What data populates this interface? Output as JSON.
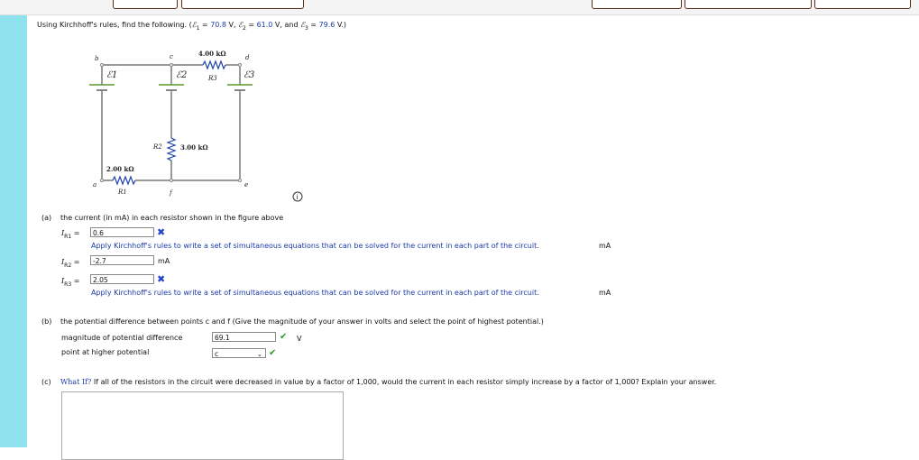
{
  "intro": {
    "text": "Using Kirchhoff's rules, find the following. (",
    "e1": "ℰ",
    "e1_sub": "1",
    "eq": " = ",
    "v1": "70.8",
    "u1": " V, ",
    "e2": "ℰ",
    "e2_sub": "2",
    "v2": "61.0",
    "u2": " V, and ",
    "e3": "ℰ",
    "e3_sub": "3",
    "v3": "79.6",
    "u3": " V.)"
  },
  "circuit": {
    "node_b": "b",
    "node_c": "c",
    "node_d": "d",
    "node_a": "a",
    "node_f": "f",
    "node_e": "e",
    "r3_value": "4.00 kΩ",
    "r3_label": "R3",
    "r2_value": "3.00 kΩ",
    "r2_label": "R2",
    "r1_value": "2.00 kΩ",
    "r1_label": "R1",
    "emf1": "ℰ1",
    "emf2": "ℰ2",
    "emf3": "ℰ3"
  },
  "part_a": {
    "label": "(a)",
    "question": "the current (in mA) in each resistor shown in the figure above",
    "rows": [
      {
        "sym": "I",
        "sub": "R1",
        "value": "0.6",
        "feedback": "Apply Kirchhoff's rules to write a set of simultaneous equations that can be solved for the current in each part of the circuit.",
        "unit": "mA"
      },
      {
        "sym": "I",
        "sub": "R2",
        "value": "-2.7",
        "unit": "mA"
      },
      {
        "sym": "I",
        "sub": "R3",
        "value": "2.05",
        "feedback": "Apply Kirchhoff's rules to write a set of simultaneous equations that can be solved for the current in each part of the circuit.",
        "unit": "mA"
      }
    ]
  },
  "part_b": {
    "label": "(b)",
    "question": "the potential difference between points c and f (Give the magnitude of your answer in volts and select the point of highest potential.)",
    "mag_label": "magnitude of potential difference",
    "mag_value": "69.1",
    "mag_unit": "V",
    "point_label": "point at higher potential",
    "point_value": "c"
  },
  "part_c": {
    "label": "(c)",
    "whatif": "What If?",
    "question": "If all of the resistors in the circuit were decreased in value by a factor of 1,000, would the current in each resistor simply increase by a factor of 1,000? Explain your answer.",
    "answer": ""
  },
  "colors": {
    "accent_blue": "#1a3aa8",
    "sidebar": "#8fe3ee",
    "check": "#2a9a2a"
  }
}
